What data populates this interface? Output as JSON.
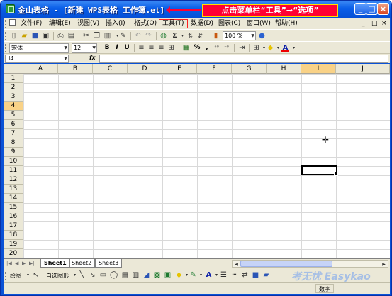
{
  "window": {
    "title": "金山表格 - [新建 WPS表格 工作簿.et]",
    "minimize": "_",
    "maximize": "□",
    "close": "×"
  },
  "annotation": {
    "text": "点击菜单栏“工具”→“选项”"
  },
  "menu": {
    "items": [
      "文件(F)",
      "编辑(E)",
      "视图(V)",
      "插入(I)",
      "格式(O)",
      "工具(T)",
      "数据(D)",
      "图表(C)",
      "窗口(W)",
      "帮助(H)"
    ],
    "highlighted_index": 5,
    "mdi_controls": [
      "_",
      "□",
      "×"
    ]
  },
  "toolbar": {
    "zoom": "100 %"
  },
  "format_bar": {
    "font": "宋体",
    "size": "12",
    "bold": "B",
    "italic": "I",
    "underline": "U",
    "percent": "%",
    "comma": ","
  },
  "formula_bar": {
    "cell_ref": "I4",
    "fx": "fx",
    "content": ""
  },
  "grid": {
    "columns": [
      "A",
      "B",
      "C",
      "D",
      "E",
      "F",
      "G",
      "H",
      "I",
      "J"
    ],
    "rows": [
      "1",
      "2",
      "3",
      "4",
      "5",
      "6",
      "7",
      "8",
      "9",
      "10",
      "11",
      "12",
      "13",
      "14",
      "15",
      "16",
      "17",
      "18",
      "19",
      "20"
    ],
    "selected_column": "I",
    "selected_row": "4"
  },
  "sheets": {
    "tabs": [
      "Sheet1",
      "Sheet2",
      "Sheet3"
    ],
    "active": "Sheet1"
  },
  "draw_bar": {
    "draw_label": "绘图",
    "autoshape_label": "自选图形"
  },
  "status_bar": {
    "mode": "数字"
  },
  "watermark": {
    "text": "考无忧 Easykao"
  }
}
